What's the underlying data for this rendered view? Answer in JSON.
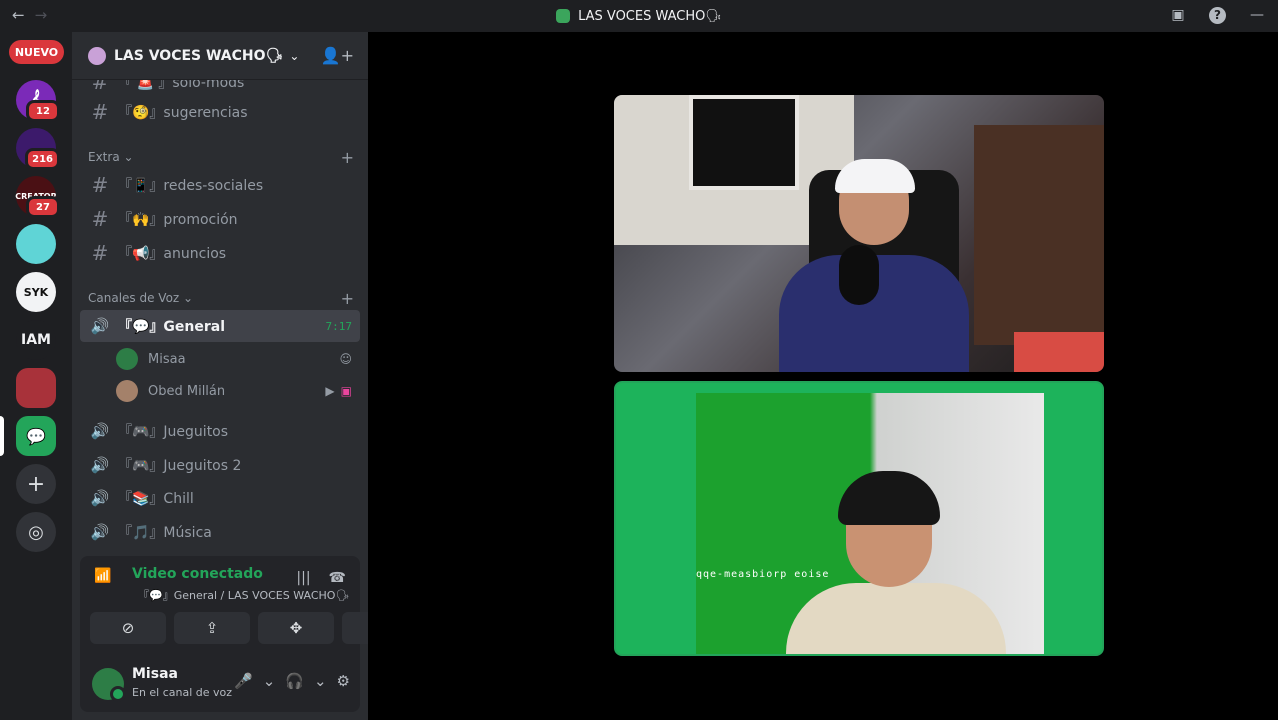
{
  "titlebar": {
    "back": "←",
    "forward": "→",
    "title": "LAS VOCES WACHO🗣",
    "minimize": "—"
  },
  "guilds": {
    "nuevo": "NUEVO",
    "items": [
      {
        "badge": "12"
      },
      {
        "badge": "216"
      },
      {
        "badge": "27"
      },
      {
        "badge": ""
      },
      {
        "label": "SYK"
      },
      {
        "label": "IAM"
      },
      {
        "badge": ""
      },
      {
        "badge": ""
      }
    ],
    "add": "+",
    "discover": "◎"
  },
  "server": {
    "name": "LAS VOCES WACHO🗣",
    "chevron": "⌄"
  },
  "channels": {
    "top_partial": "『 🚨 』solo-mods",
    "sugerencias": "『🧐』sugerencias",
    "category_extra": "Extra ⌄",
    "redes": "『📱』redes-sociales",
    "promocion": "『🙌』promoción",
    "anuncios": "『📢』anuncios",
    "category_voz": "Canales de Voz ⌄",
    "general": "『💬』General",
    "general_time": "7:17",
    "voice_users": [
      {
        "name": "Misaa"
      },
      {
        "name": "Obed Millán"
      }
    ],
    "jueguitos": "『🎮』Jueguitos",
    "jueguitos2": "『🎮』Jueguitos 2",
    "chill": "『📚』Chill",
    "musica": "『🎵』Música"
  },
  "voice_panel": {
    "status": "Video conectado",
    "location": "『💬』General / LAS VOCES WACHO🗣"
  },
  "user_panel": {
    "name": "Misaa",
    "status": "En el canal de voz"
  },
  "stage": {
    "tile2_mirrored_text": "qqe-measbiorp eoise"
  },
  "colors": {
    "accent_green": "#23a55a",
    "badge_red": "#da373c",
    "sidebar": "#2b2d31",
    "guild_bar": "#1e1f22"
  }
}
